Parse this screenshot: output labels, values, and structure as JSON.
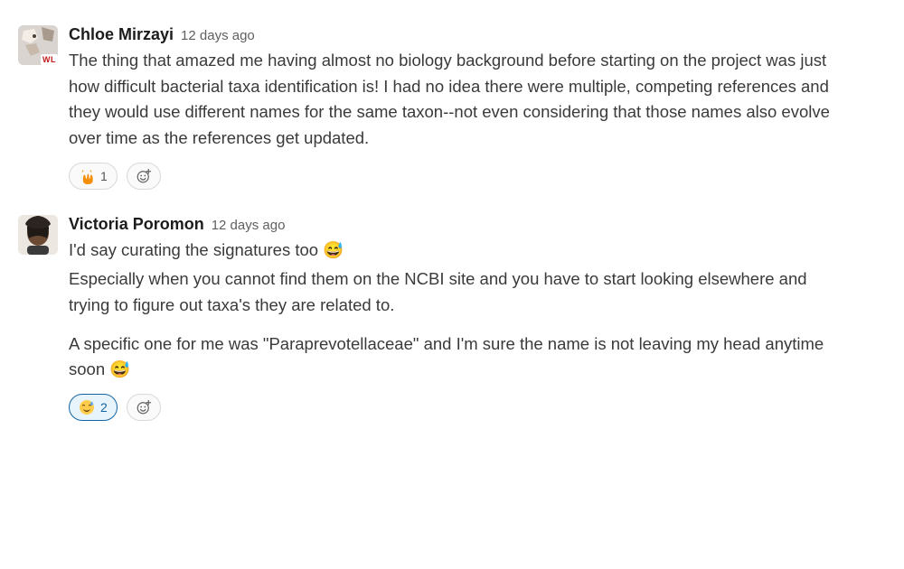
{
  "messages": [
    {
      "author": "Chloe Mirzayi",
      "timestamp": "12 days ago",
      "avatar_badge": "WL",
      "paragraphs": [
        "The thing that amazed me having almost no biology background before starting on the project was just how difficult bacterial taxa identification is! I had no idea there were multiple, competing references and they would use different names for the same taxon--not even considering that those names also evolve over time as the references get updated."
      ],
      "reactions": [
        {
          "emoji": "raised-hands",
          "count": 1,
          "selected": false
        }
      ]
    },
    {
      "author": "Victoria Poromon",
      "timestamp": "12 days ago",
      "paragraphs": [
        "I'd say curating the signatures too 😅",
        "Especially when you cannot find them on the NCBI site and you have to start looking elsewhere and trying to figure out taxa's they are related to.",
        "A specific one for me was \"Paraprevotellaceae\" and I'm sure the name is not leaving my head anytime soon 😅"
      ],
      "paragraph_emojis": {
        "0": "sweat-smile",
        "2": "sweat-smile"
      },
      "reactions": [
        {
          "emoji": "sweat-smile",
          "count": 2,
          "selected": true
        }
      ]
    }
  ],
  "add_reaction_label": "Add reaction"
}
